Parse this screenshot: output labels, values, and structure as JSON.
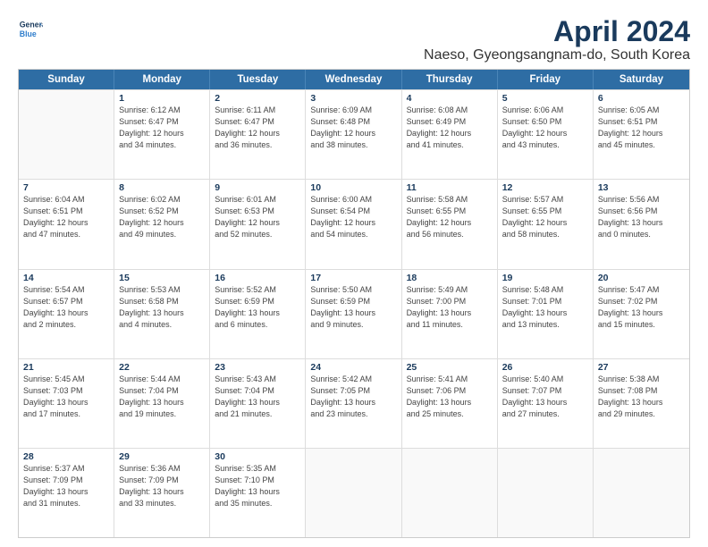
{
  "logo": {
    "line1": "General",
    "line2": "Blue"
  },
  "title": "April 2024",
  "subtitle": "Naeso, Gyeongsangnam-do, South Korea",
  "weekdays": [
    "Sunday",
    "Monday",
    "Tuesday",
    "Wednesday",
    "Thursday",
    "Friday",
    "Saturday"
  ],
  "rows": [
    [
      {
        "day": "",
        "sunrise": "",
        "sunset": "",
        "daylight": ""
      },
      {
        "day": "1",
        "sunrise": "Sunrise: 6:12 AM",
        "sunset": "Sunset: 6:47 PM",
        "daylight": "Daylight: 12 hours",
        "daylight2": "and 34 minutes."
      },
      {
        "day": "2",
        "sunrise": "Sunrise: 6:11 AM",
        "sunset": "Sunset: 6:47 PM",
        "daylight": "Daylight: 12 hours",
        "daylight2": "and 36 minutes."
      },
      {
        "day": "3",
        "sunrise": "Sunrise: 6:09 AM",
        "sunset": "Sunset: 6:48 PM",
        "daylight": "Daylight: 12 hours",
        "daylight2": "and 38 minutes."
      },
      {
        "day": "4",
        "sunrise": "Sunrise: 6:08 AM",
        "sunset": "Sunset: 6:49 PM",
        "daylight": "Daylight: 12 hours",
        "daylight2": "and 41 minutes."
      },
      {
        "day": "5",
        "sunrise": "Sunrise: 6:06 AM",
        "sunset": "Sunset: 6:50 PM",
        "daylight": "Daylight: 12 hours",
        "daylight2": "and 43 minutes."
      },
      {
        "day": "6",
        "sunrise": "Sunrise: 6:05 AM",
        "sunset": "Sunset: 6:51 PM",
        "daylight": "Daylight: 12 hours",
        "daylight2": "and 45 minutes."
      }
    ],
    [
      {
        "day": "7",
        "sunrise": "Sunrise: 6:04 AM",
        "sunset": "Sunset: 6:51 PM",
        "daylight": "Daylight: 12 hours",
        "daylight2": "and 47 minutes."
      },
      {
        "day": "8",
        "sunrise": "Sunrise: 6:02 AM",
        "sunset": "Sunset: 6:52 PM",
        "daylight": "Daylight: 12 hours",
        "daylight2": "and 49 minutes."
      },
      {
        "day": "9",
        "sunrise": "Sunrise: 6:01 AM",
        "sunset": "Sunset: 6:53 PM",
        "daylight": "Daylight: 12 hours",
        "daylight2": "and 52 minutes."
      },
      {
        "day": "10",
        "sunrise": "Sunrise: 6:00 AM",
        "sunset": "Sunset: 6:54 PM",
        "daylight": "Daylight: 12 hours",
        "daylight2": "and 54 minutes."
      },
      {
        "day": "11",
        "sunrise": "Sunrise: 5:58 AM",
        "sunset": "Sunset: 6:55 PM",
        "daylight": "Daylight: 12 hours",
        "daylight2": "and 56 minutes."
      },
      {
        "day": "12",
        "sunrise": "Sunrise: 5:57 AM",
        "sunset": "Sunset: 6:55 PM",
        "daylight": "Daylight: 12 hours",
        "daylight2": "and 58 minutes."
      },
      {
        "day": "13",
        "sunrise": "Sunrise: 5:56 AM",
        "sunset": "Sunset: 6:56 PM",
        "daylight": "Daylight: 13 hours",
        "daylight2": "and 0 minutes."
      }
    ],
    [
      {
        "day": "14",
        "sunrise": "Sunrise: 5:54 AM",
        "sunset": "Sunset: 6:57 PM",
        "daylight": "Daylight: 13 hours",
        "daylight2": "and 2 minutes."
      },
      {
        "day": "15",
        "sunrise": "Sunrise: 5:53 AM",
        "sunset": "Sunset: 6:58 PM",
        "daylight": "Daylight: 13 hours",
        "daylight2": "and 4 minutes."
      },
      {
        "day": "16",
        "sunrise": "Sunrise: 5:52 AM",
        "sunset": "Sunset: 6:59 PM",
        "daylight": "Daylight: 13 hours",
        "daylight2": "and 6 minutes."
      },
      {
        "day": "17",
        "sunrise": "Sunrise: 5:50 AM",
        "sunset": "Sunset: 6:59 PM",
        "daylight": "Daylight: 13 hours",
        "daylight2": "and 9 minutes."
      },
      {
        "day": "18",
        "sunrise": "Sunrise: 5:49 AM",
        "sunset": "Sunset: 7:00 PM",
        "daylight": "Daylight: 13 hours",
        "daylight2": "and 11 minutes."
      },
      {
        "day": "19",
        "sunrise": "Sunrise: 5:48 AM",
        "sunset": "Sunset: 7:01 PM",
        "daylight": "Daylight: 13 hours",
        "daylight2": "and 13 minutes."
      },
      {
        "day": "20",
        "sunrise": "Sunrise: 5:47 AM",
        "sunset": "Sunset: 7:02 PM",
        "daylight": "Daylight: 13 hours",
        "daylight2": "and 15 minutes."
      }
    ],
    [
      {
        "day": "21",
        "sunrise": "Sunrise: 5:45 AM",
        "sunset": "Sunset: 7:03 PM",
        "daylight": "Daylight: 13 hours",
        "daylight2": "and 17 minutes."
      },
      {
        "day": "22",
        "sunrise": "Sunrise: 5:44 AM",
        "sunset": "Sunset: 7:04 PM",
        "daylight": "Daylight: 13 hours",
        "daylight2": "and 19 minutes."
      },
      {
        "day": "23",
        "sunrise": "Sunrise: 5:43 AM",
        "sunset": "Sunset: 7:04 PM",
        "daylight": "Daylight: 13 hours",
        "daylight2": "and 21 minutes."
      },
      {
        "day": "24",
        "sunrise": "Sunrise: 5:42 AM",
        "sunset": "Sunset: 7:05 PM",
        "daylight": "Daylight: 13 hours",
        "daylight2": "and 23 minutes."
      },
      {
        "day": "25",
        "sunrise": "Sunrise: 5:41 AM",
        "sunset": "Sunset: 7:06 PM",
        "daylight": "Daylight: 13 hours",
        "daylight2": "and 25 minutes."
      },
      {
        "day": "26",
        "sunrise": "Sunrise: 5:40 AM",
        "sunset": "Sunset: 7:07 PM",
        "daylight": "Daylight: 13 hours",
        "daylight2": "and 27 minutes."
      },
      {
        "day": "27",
        "sunrise": "Sunrise: 5:38 AM",
        "sunset": "Sunset: 7:08 PM",
        "daylight": "Daylight: 13 hours",
        "daylight2": "and 29 minutes."
      }
    ],
    [
      {
        "day": "28",
        "sunrise": "Sunrise: 5:37 AM",
        "sunset": "Sunset: 7:09 PM",
        "daylight": "Daylight: 13 hours",
        "daylight2": "and 31 minutes."
      },
      {
        "day": "29",
        "sunrise": "Sunrise: 5:36 AM",
        "sunset": "Sunset: 7:09 PM",
        "daylight": "Daylight: 13 hours",
        "daylight2": "and 33 minutes."
      },
      {
        "day": "30",
        "sunrise": "Sunrise: 5:35 AM",
        "sunset": "Sunset: 7:10 PM",
        "daylight": "Daylight: 13 hours",
        "daylight2": "and 35 minutes."
      },
      {
        "day": "",
        "sunrise": "",
        "sunset": "",
        "daylight": ""
      },
      {
        "day": "",
        "sunrise": "",
        "sunset": "",
        "daylight": ""
      },
      {
        "day": "",
        "sunrise": "",
        "sunset": "",
        "daylight": ""
      },
      {
        "day": "",
        "sunrise": "",
        "sunset": "",
        "daylight": ""
      }
    ]
  ]
}
